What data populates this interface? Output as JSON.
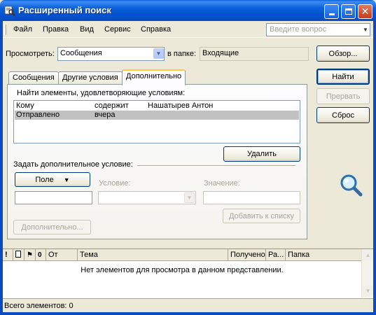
{
  "window": {
    "title": "Расширенный поиск"
  },
  "menu": {
    "items": [
      "Файл",
      "Правка",
      "Вид",
      "Сервис",
      "Справка"
    ],
    "help_placeholder": "Введите вопрос"
  },
  "look_for": {
    "label": "Просмотреть:",
    "value": "Сообщения"
  },
  "folder": {
    "label": "в папке:",
    "value": "Входящие",
    "browse_button": "Обзор..."
  },
  "tabs": [
    {
      "label": "Сообщения",
      "active": false
    },
    {
      "label": "Другие условия",
      "active": false
    },
    {
      "label": "Дополнительно",
      "active": true
    }
  ],
  "side_buttons": {
    "find": "Найти",
    "stop": "Прервать",
    "clear": "Сброс"
  },
  "advanced": {
    "criteria_label": "Найти элементы, удовлетворяющие условиям:",
    "criteria": [
      {
        "field": "Кому",
        "condition": "содержит",
        "value": "Нашатырев Антон",
        "selected": false
      },
      {
        "field": "Отправлено",
        "condition": "вчера",
        "value": "",
        "selected": true
      }
    ],
    "delete_button": "Удалить",
    "define_label": "Задать дополнительное условие:",
    "field_button": "Поле",
    "condition_label": "Условие:",
    "value_label": "Значение:",
    "add_button": "Добавить к списку",
    "more_button": "Дополнительно..."
  },
  "results": {
    "columns": [
      "!",
      "",
      "",
      "",
      "От",
      "Тема",
      "Получено",
      "Ра...",
      "Папка"
    ],
    "empty_message": "Нет элементов для просмотра в данном представлении."
  },
  "status": {
    "text": "Всего элементов: 0"
  },
  "colors": {
    "titlebar": "#0a5fd8",
    "frame": "#0a4bc0",
    "selection": "#c1c1c1",
    "tab_highlight": "#ffc83c"
  }
}
